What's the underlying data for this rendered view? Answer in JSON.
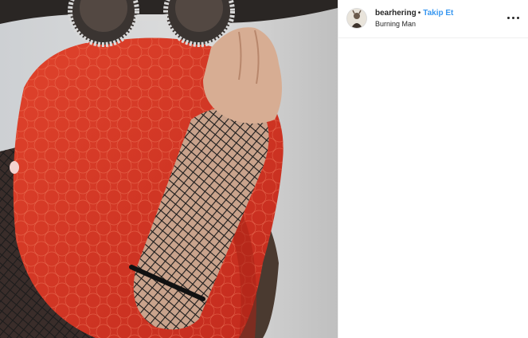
{
  "post": {
    "username": "bearhering",
    "separator": "•",
    "follow_label": "Takip Et",
    "location": "Burning Man",
    "more_icon": "more-options-icon",
    "media_alt": "post-photo"
  },
  "colors": {
    "follow_blue": "#3897f0",
    "text_dark": "#262626",
    "divider": "#efefef",
    "scarf_red": "#d83a2a"
  }
}
